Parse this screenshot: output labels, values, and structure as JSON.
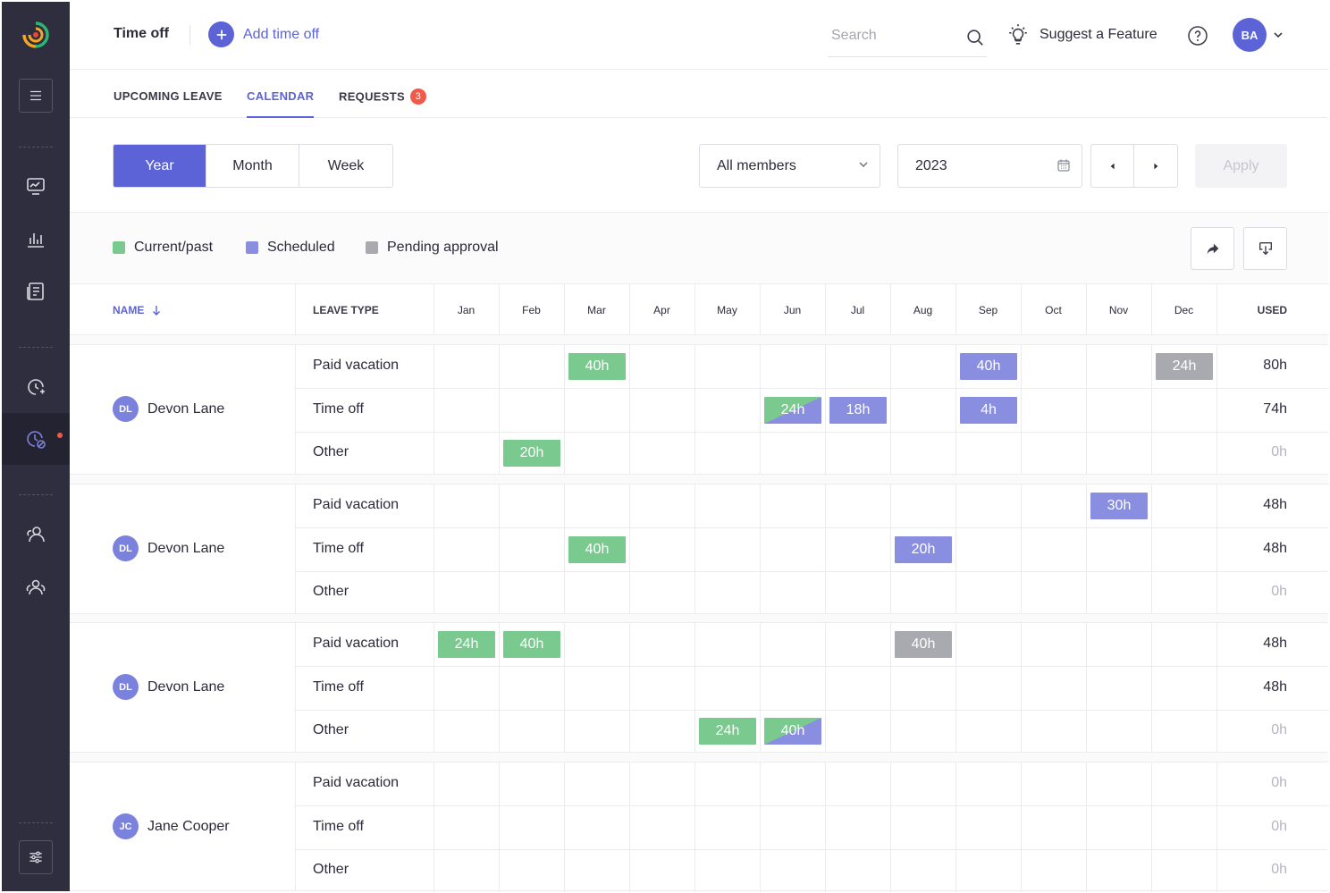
{
  "header": {
    "title": "Time off",
    "add_label": "Add time off",
    "search_placeholder": "Search",
    "suggest_label": "Suggest a Feature",
    "avatar_initials": "BA"
  },
  "tabs": [
    {
      "label": "UPCOMING LEAVE"
    },
    {
      "label": "CALENDAR"
    },
    {
      "label": "REQUESTS",
      "badge": "3"
    }
  ],
  "controls": {
    "view_options": [
      "Year",
      "Month",
      "Week"
    ],
    "members_value": "All members",
    "year_value": "2023",
    "apply_label": "Apply"
  },
  "legend": [
    {
      "label": "Current/past",
      "color": "#7ac98f"
    },
    {
      "label": "Scheduled",
      "color": "#8a8ee0"
    },
    {
      "label": "Pending approval",
      "color": "#a9a9b0"
    }
  ],
  "table": {
    "name_header": "NAME",
    "type_header": "LEAVE TYPE",
    "months": [
      "Jan",
      "Feb",
      "Mar",
      "Apr",
      "May",
      "Jun",
      "Jul",
      "Aug",
      "Sep",
      "Oct",
      "Nov",
      "Dec"
    ],
    "used_header": "USED",
    "members": [
      {
        "initials": "DL",
        "name": "Devon Lane",
        "rows": [
          {
            "type": "Paid vacation",
            "used": "80h",
            "entries": [
              {
                "month": 2,
                "value": "40h",
                "status": "current"
              },
              {
                "month": 8,
                "value": "40h",
                "status": "sched"
              },
              {
                "month": 11,
                "value": "24h",
                "status": "pending"
              }
            ]
          },
          {
            "type": "Time off",
            "used": "74h",
            "entries": [
              {
                "month": 5,
                "value": "24h",
                "status": "split"
              },
              {
                "month": 6,
                "value": "18h",
                "status": "sched"
              },
              {
                "month": 8,
                "value": "4h",
                "status": "sched"
              }
            ]
          },
          {
            "type": "Other",
            "used": "0h",
            "entries": [
              {
                "month": 1,
                "value": "20h",
                "status": "current"
              }
            ]
          }
        ]
      },
      {
        "initials": "DL",
        "name": "Devon Lane",
        "rows": [
          {
            "type": "Paid vacation",
            "used": "48h",
            "entries": [
              {
                "month": 10,
                "value": "30h",
                "status": "sched"
              }
            ]
          },
          {
            "type": "Time off",
            "used": "48h",
            "entries": [
              {
                "month": 2,
                "value": "40h",
                "status": "current"
              },
              {
                "month": 7,
                "value": "20h",
                "status": "sched"
              }
            ]
          },
          {
            "type": "Other",
            "used": "0h",
            "entries": []
          }
        ]
      },
      {
        "initials": "DL",
        "name": "Devon Lane",
        "rows": [
          {
            "type": "Paid vacation",
            "used": "48h",
            "entries": [
              {
                "month": 0,
                "value": "24h",
                "status": "current"
              },
              {
                "month": 1,
                "value": "40h",
                "status": "current"
              },
              {
                "month": 7,
                "value": "40h",
                "status": "pending"
              }
            ]
          },
          {
            "type": "Time off",
            "used": "48h",
            "entries": []
          },
          {
            "type": "Other",
            "used": "0h",
            "entries": [
              {
                "month": 4,
                "value": "24h",
                "status": "current"
              },
              {
                "month": 5,
                "value": "40h",
                "status": "split"
              }
            ]
          }
        ]
      },
      {
        "initials": "JC",
        "name": "Jane Cooper",
        "rows": [
          {
            "type": "Paid vacation",
            "used": "0h",
            "entries": []
          },
          {
            "type": "Time off",
            "used": "0h",
            "entries": []
          },
          {
            "type": "Other",
            "used": "0h",
            "entries": []
          }
        ]
      }
    ]
  }
}
